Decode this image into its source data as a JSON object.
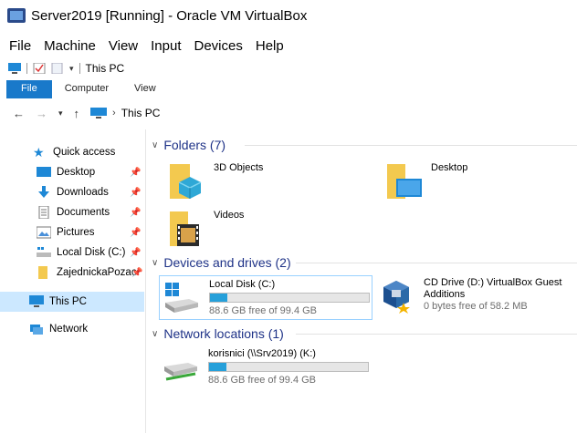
{
  "host": {
    "title": "Server2019 [Running] - Oracle VM VirtualBox",
    "menu": [
      "File",
      "Machine",
      "View",
      "Input",
      "Devices",
      "Help"
    ]
  },
  "explorer": {
    "qat_title": "This PC",
    "ribbon_tabs": [
      "File",
      "Computer",
      "View"
    ],
    "breadcrumb": "This PC",
    "nav": {
      "quick_access": "Quick access",
      "items": [
        "Desktop",
        "Downloads",
        "Documents",
        "Pictures",
        "Local Disk (C:)",
        "ZajednickaPozac"
      ],
      "this_pc": "This PC",
      "network": "Network"
    },
    "folders_header": "Folders (7)",
    "folders": [
      "3D Objects",
      "Desktop",
      "Videos"
    ],
    "drives_header": "Devices and drives (2)",
    "drives": [
      {
        "name": "Local Disk (C:)",
        "free": "88.6 GB free of 99.4 GB",
        "used_fraction": 0.11
      },
      {
        "name": "CD Drive (D:) VirtualBox Guest Additions",
        "free": "0 bytes free of 58.2 MB"
      }
    ],
    "network_header": "Network locations (1)",
    "network_locations": [
      {
        "name": "korisnici (\\\\Srv2019) (K:)",
        "free": "88.6 GB free of 99.4 GB",
        "used_fraction": 0.11
      }
    ]
  },
  "colors": {
    "accent": "#1979ca",
    "selection": "#cce8ff",
    "group_header": "#1e3287",
    "bar_fill": "#26a0da"
  }
}
